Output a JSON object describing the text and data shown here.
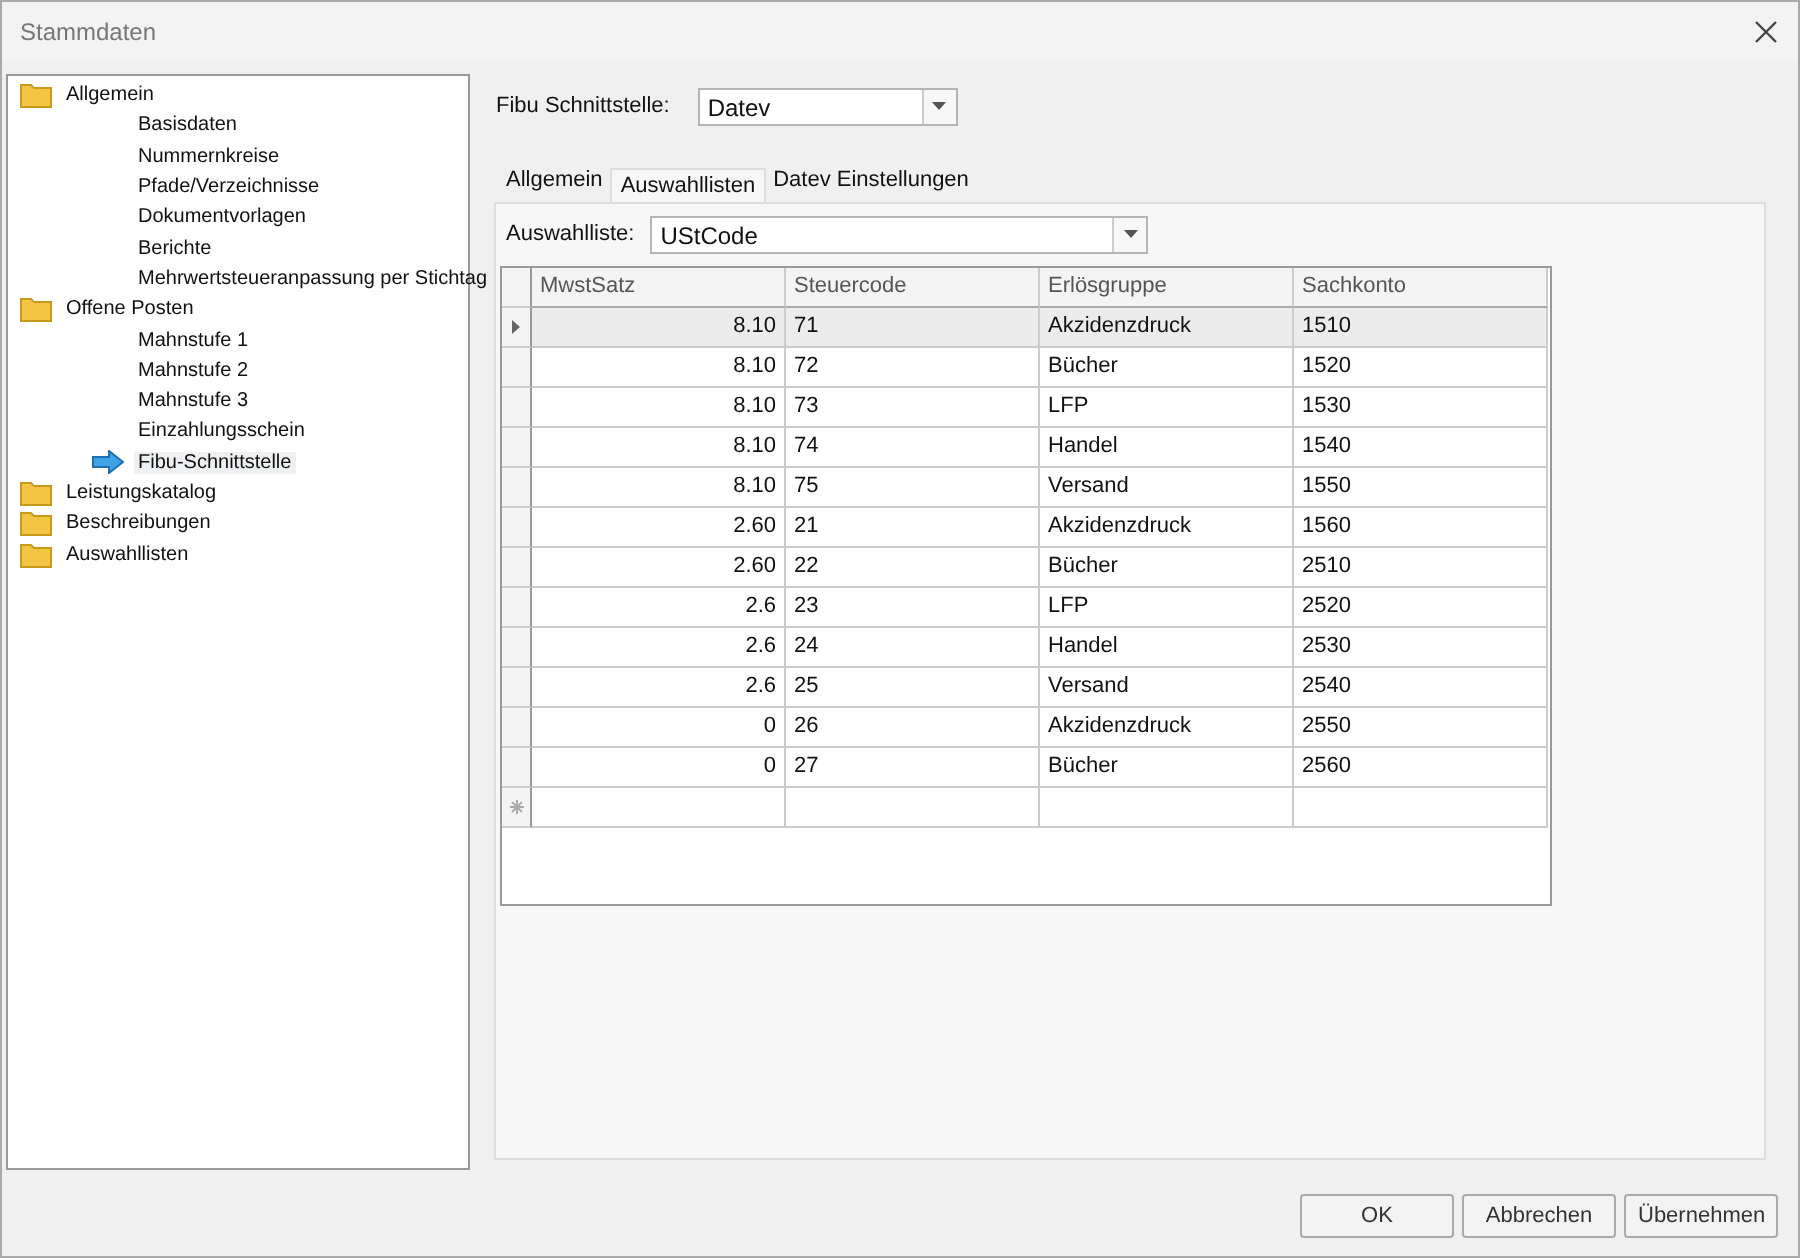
{
  "window": {
    "title": "Stammdaten"
  },
  "tree": [
    {
      "label": "Allgemein",
      "selected": false,
      "children": [
        {
          "label": "Basisdaten",
          "selected": false
        },
        {
          "label": "Nummernkreise",
          "selected": false
        },
        {
          "label": "Pfade/Verzeichnisse",
          "selected": false
        },
        {
          "label": "Dokumentvorlagen",
          "selected": false
        },
        {
          "label": "Berichte",
          "selected": false
        },
        {
          "label": "Mehrwertsteueranpassung per Stichtag",
          "selected": false
        }
      ]
    },
    {
      "label": "Offene Posten",
      "selected": false,
      "children": [
        {
          "label": "Mahnstufe 1",
          "selected": false
        },
        {
          "label": "Mahnstufe 2",
          "selected": false
        },
        {
          "label": "Mahnstufe 3",
          "selected": false
        },
        {
          "label": "Einzahlungsschein",
          "selected": false
        },
        {
          "label": "Fibu-Schnittstelle",
          "selected": true
        }
      ]
    },
    {
      "label": "Leistungskatalog",
      "selected": false
    },
    {
      "label": "Beschreibungen",
      "selected": false
    },
    {
      "label": "Auswahllisten",
      "selected": false
    }
  ],
  "interface_field": {
    "label": "Fibu Schnittstelle:",
    "value": "Datev"
  },
  "tabs": [
    {
      "label": "Allgemein",
      "selected": false
    },
    {
      "label": "Auswahllisten",
      "selected": true
    },
    {
      "label": "Datev Einstellungen",
      "selected": false
    }
  ],
  "list_field": {
    "label": "Auswahlliste:",
    "value": "UStCode"
  },
  "table": {
    "columns": [
      "MwstSatz",
      "Steuercode",
      "Erlösgruppe",
      "Sachkonto"
    ],
    "rows": [
      {
        "cells": [
          "8.10",
          "71",
          "Akzidenzdruck",
          "1510"
        ],
        "selected": true
      },
      {
        "cells": [
          "8.10",
          "72",
          "Bücher",
          "1520"
        ],
        "selected": false
      },
      {
        "cells": [
          "8.10",
          "73",
          "LFP",
          "1530"
        ],
        "selected": false
      },
      {
        "cells": [
          "8.10",
          "74",
          "Handel",
          "1540"
        ],
        "selected": false
      },
      {
        "cells": [
          "8.10",
          "75",
          "Versand",
          "1550"
        ],
        "selected": false
      },
      {
        "cells": [
          "2.60",
          "21",
          "Akzidenzdruck",
          "1560"
        ],
        "selected": false
      },
      {
        "cells": [
          "2.60",
          "22",
          "Bücher",
          "2510"
        ],
        "selected": false
      },
      {
        "cells": [
          "2.6",
          "23",
          "LFP",
          "2520"
        ],
        "selected": false
      },
      {
        "cells": [
          "2.6",
          "24",
          "Handel",
          "2530"
        ],
        "selected": false
      },
      {
        "cells": [
          "2.6",
          "25",
          "Versand",
          "2540"
        ],
        "selected": false
      },
      {
        "cells": [
          "0",
          "26",
          "Akzidenzdruck",
          "2550"
        ],
        "selected": false
      },
      {
        "cells": [
          "0",
          "27",
          "Bücher",
          "2560"
        ],
        "selected": false
      }
    ]
  },
  "buttons": [
    "OK",
    "Abbrechen",
    "Übernehmen"
  ]
}
